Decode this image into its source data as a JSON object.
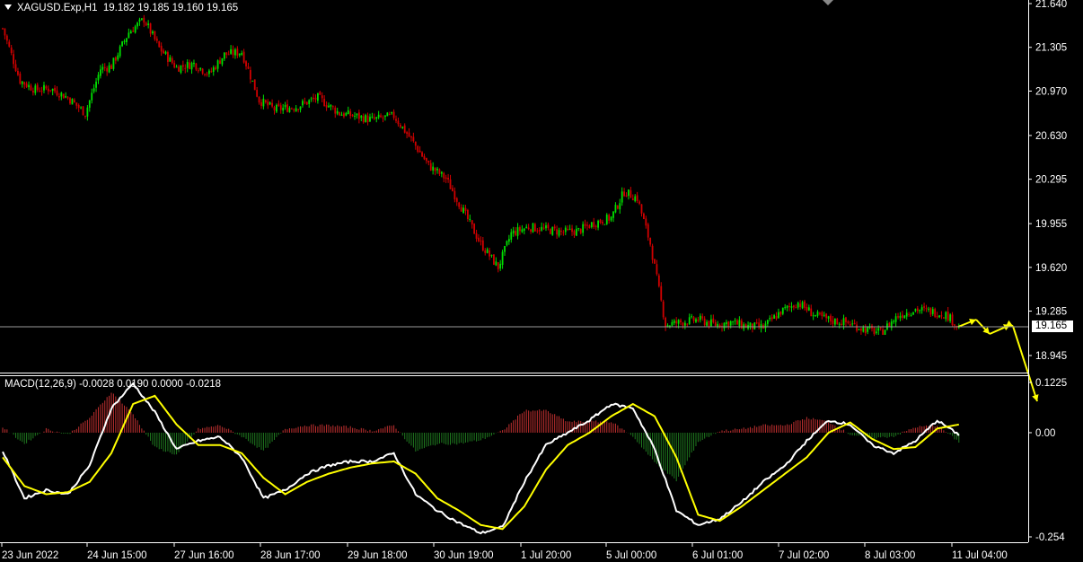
{
  "header": {
    "symbol": "XAGUSD.Exp,H1",
    "ohlc": "19.182 19.185 19.160 19.165"
  },
  "macd": {
    "label": "MACD(12,26,9) -0.0028 0.0190 0.0000 -0.0218"
  },
  "current_price_label": "19.165",
  "colors": {
    "background": "#000000",
    "bull": "#00e000",
    "bear": "#d00000",
    "macd_line": "#ffffff",
    "signal_line": "#ffff00",
    "hist_pos": "#c03030",
    "hist_neg": "#1f7a1f",
    "projection": "#ffff00",
    "axis": "#ffffff"
  },
  "chart_data": [
    {
      "type": "candlestick",
      "title": "",
      "y_ticks": [
        "21.640",
        "21.305",
        "20.970",
        "20.630",
        "20.295",
        "19.955",
        "19.620",
        "19.285",
        "18.945"
      ],
      "ylim": [
        18.82,
        21.64
      ],
      "current_price": 19.165,
      "close_path_anchors": [
        [
          0,
          21.45
        ],
        [
          8,
          21.05
        ],
        [
          15,
          20.98
        ],
        [
          22,
          20.99
        ],
        [
          30,
          20.92
        ],
        [
          38,
          20.8
        ],
        [
          45,
          21.14
        ],
        [
          50,
          21.16
        ],
        [
          58,
          21.42
        ],
        [
          65,
          21.52
        ],
        [
          72,
          21.3
        ],
        [
          80,
          21.15
        ],
        [
          88,
          21.18
        ],
        [
          95,
          21.1
        ],
        [
          102,
          21.25
        ],
        [
          110,
          21.27
        ],
        [
          118,
          20.9
        ],
        [
          125,
          20.83
        ],
        [
          135,
          20.85
        ],
        [
          145,
          20.92
        ],
        [
          155,
          20.8
        ],
        [
          162,
          20.78
        ],
        [
          170,
          20.75
        ],
        [
          180,
          20.78
        ],
        [
          188,
          20.6
        ],
        [
          196,
          20.4
        ],
        [
          204,
          20.3
        ],
        [
          212,
          20.05
        ],
        [
          220,
          19.8
        ],
        [
          228,
          19.62
        ],
        [
          234,
          19.88
        ],
        [
          242,
          19.93
        ],
        [
          250,
          19.91
        ],
        [
          258,
          19.89
        ],
        [
          265,
          19.9
        ],
        [
          272,
          19.96
        ],
        [
          280,
          20.0
        ],
        [
          286,
          20.2
        ],
        [
          292,
          20.15
        ],
        [
          298,
          19.8
        ],
        [
          305,
          19.18
        ],
        [
          312,
          19.2
        ],
        [
          320,
          19.22
        ],
        [
          328,
          19.18
        ],
        [
          335,
          19.2
        ],
        [
          342,
          19.17
        ],
        [
          350,
          19.16
        ],
        [
          358,
          19.28
        ],
        [
          366,
          19.35
        ],
        [
          374,
          19.25
        ],
        [
          382,
          19.21
        ],
        [
          388,
          19.2
        ],
        [
          396,
          19.15
        ],
        [
          404,
          19.12
        ],
        [
          412,
          19.25
        ],
        [
          420,
          19.3
        ],
        [
          428,
          19.28
        ],
        [
          434,
          19.26
        ],
        [
          440,
          19.165
        ]
      ],
      "projection": [
        19.165,
        19.22,
        19.11,
        19.18,
        19.17,
        18.6
      ]
    },
    {
      "type": "line",
      "title": "MACD(12,26,9)",
      "y_ticks": [
        "0.1225",
        "0.00",
        "-0.254"
      ],
      "ylim": [
        -0.254,
        0.1225
      ],
      "macd_anchors": [
        [
          0,
          -0.045
        ],
        [
          10,
          -0.16
        ],
        [
          20,
          -0.14
        ],
        [
          30,
          -0.15
        ],
        [
          40,
          -0.08
        ],
        [
          50,
          0.06
        ],
        [
          60,
          0.12
        ],
        [
          70,
          0.05
        ],
        [
          80,
          -0.04
        ],
        [
          90,
          -0.02
        ],
        [
          100,
          -0.01
        ],
        [
          110,
          -0.06
        ],
        [
          120,
          -0.16
        ],
        [
          130,
          -0.14
        ],
        [
          140,
          -0.1
        ],
        [
          150,
          -0.08
        ],
        [
          160,
          -0.07
        ],
        [
          170,
          -0.07
        ],
        [
          180,
          -0.05
        ],
        [
          190,
          -0.15
        ],
        [
          200,
          -0.19
        ],
        [
          210,
          -0.22
        ],
        [
          220,
          -0.245
        ],
        [
          230,
          -0.23
        ],
        [
          240,
          -0.12
        ],
        [
          250,
          -0.03
        ],
        [
          260,
          0.0
        ],
        [
          270,
          0.03
        ],
        [
          280,
          0.07
        ],
        [
          290,
          0.06
        ],
        [
          300,
          -0.04
        ],
        [
          310,
          -0.19
        ],
        [
          320,
          -0.225
        ],
        [
          330,
          -0.21
        ],
        [
          340,
          -0.17
        ],
        [
          350,
          -0.12
        ],
        [
          360,
          -0.08
        ],
        [
          370,
          -0.02
        ],
        [
          380,
          0.03
        ],
        [
          390,
          0.02
        ],
        [
          400,
          -0.03
        ],
        [
          410,
          -0.05
        ],
        [
          420,
          -0.02
        ],
        [
          430,
          0.03
        ],
        [
          440,
          -0.005
        ]
      ],
      "signal_anchors": [
        [
          0,
          -0.06
        ],
        [
          10,
          -0.13
        ],
        [
          20,
          -0.15
        ],
        [
          30,
          -0.145
        ],
        [
          40,
          -0.12
        ],
        [
          50,
          -0.05
        ],
        [
          60,
          0.07
        ],
        [
          70,
          0.09
        ],
        [
          80,
          0.02
        ],
        [
          90,
          -0.03
        ],
        [
          100,
          -0.03
        ],
        [
          110,
          -0.05
        ],
        [
          120,
          -0.11
        ],
        [
          130,
          -0.15
        ],
        [
          140,
          -0.12
        ],
        [
          150,
          -0.1
        ],
        [
          160,
          -0.085
        ],
        [
          170,
          -0.075
        ],
        [
          180,
          -0.07
        ],
        [
          190,
          -0.1
        ],
        [
          200,
          -0.16
        ],
        [
          210,
          -0.19
        ],
        [
          220,
          -0.225
        ],
        [
          230,
          -0.235
        ],
        [
          240,
          -0.18
        ],
        [
          250,
          -0.09
        ],
        [
          260,
          -0.03
        ],
        [
          270,
          0.0
        ],
        [
          280,
          0.04
        ],
        [
          290,
          0.07
        ],
        [
          300,
          0.04
        ],
        [
          310,
          -0.06
        ],
        [
          320,
          -0.2
        ],
        [
          330,
          -0.215
        ],
        [
          340,
          -0.18
        ],
        [
          350,
          -0.14
        ],
        [
          360,
          -0.1
        ],
        [
          370,
          -0.06
        ],
        [
          380,
          0.0
        ],
        [
          390,
          0.025
        ],
        [
          400,
          -0.015
        ],
        [
          410,
          -0.04
        ],
        [
          420,
          -0.035
        ],
        [
          430,
          0.01
        ],
        [
          440,
          0.02
        ]
      ]
    }
  ],
  "x_ticks": [
    "23 Jun 2022",
    "24 Jun 15:00",
    "27 Jun 16:00",
    "28 Jun 17:00",
    "29 Jun 18:00",
    "30 Jun 19:00",
    "1 Jul 20:00",
    "5 Jul 00:00",
    "6 Jul 01:00",
    "7 Jul 02:00",
    "8 Jul 03:00",
    "11 Jul 04:00"
  ]
}
